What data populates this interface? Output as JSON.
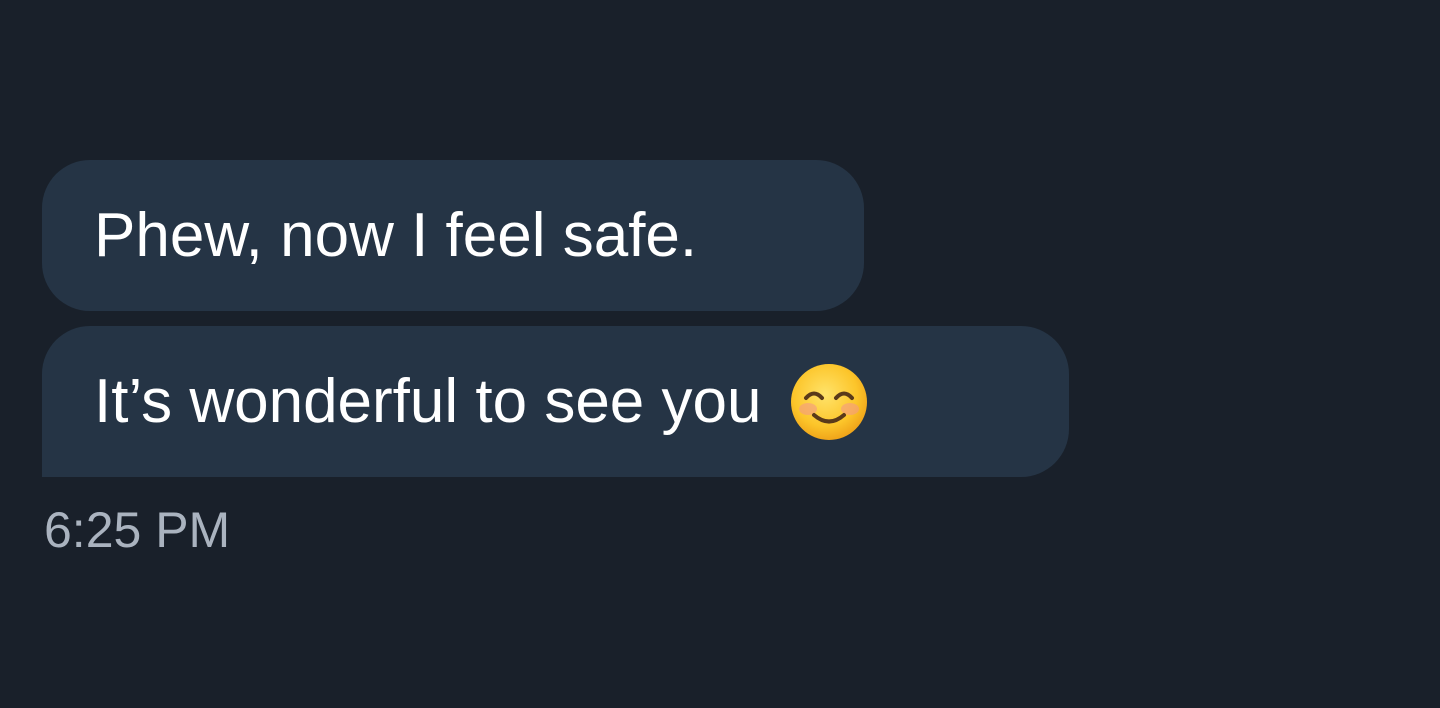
{
  "messages": [
    {
      "text": "Phew, now I feel safe."
    },
    {
      "text": "It’s wonderful to see you",
      "emoji": "smiling-face-with-smiling-eyes-icon"
    }
  ],
  "timestamp": "6:25 PM",
  "colors": {
    "background": "#19202a",
    "bubble": "#253445",
    "message_text": "#ffffff",
    "timestamp_text": "#aab3bf"
  }
}
